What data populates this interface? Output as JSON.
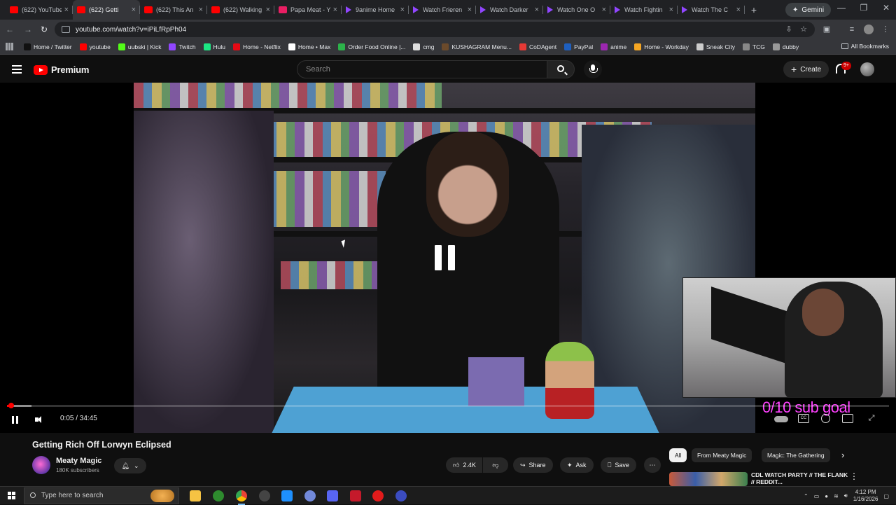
{
  "browser": {
    "tabs": [
      {
        "title": "(622) YouTube",
        "favicon": "youtube-icon",
        "active": false
      },
      {
        "title": "(622) Getti",
        "favicon": "youtube-icon",
        "active": true
      },
      {
        "title": "(622) This An",
        "favicon": "youtube-icon",
        "active": false
      },
      {
        "title": "(622) Walking",
        "favicon": "youtube-icon",
        "active": false
      },
      {
        "title": "Papa Meat - Y",
        "favicon": "papa-meat-icon",
        "active": false
      },
      {
        "title": "9anime Home",
        "favicon": "play-triangle-icon",
        "active": false
      },
      {
        "title": "Watch Frieren",
        "favicon": "play-triangle-icon",
        "active": false
      },
      {
        "title": "Watch Darker",
        "favicon": "play-triangle-icon",
        "active": false
      },
      {
        "title": "Watch One O",
        "favicon": "play-triangle-icon",
        "active": false
      },
      {
        "title": "Watch Fightin",
        "favicon": "play-triangle-icon",
        "active": false
      },
      {
        "title": "Watch The C",
        "favicon": "play-triangle-icon",
        "active": false
      }
    ],
    "gemini_label": "Gemini",
    "url": "youtube.com/watch?v=iPiLfRpPh04",
    "bookmarks": [
      {
        "label": "Home / Twitter",
        "color": "#111111"
      },
      {
        "label": "youtube",
        "color": "#ff0000"
      },
      {
        "label": "uubski | Kick",
        "color": "#53fc18"
      },
      {
        "label": "Twitch",
        "color": "#9146ff"
      },
      {
        "label": "Hulu",
        "color": "#1ce783"
      },
      {
        "label": "Home - Netflix",
        "color": "#e50914"
      },
      {
        "label": "Home • Max",
        "color": "#ffffff"
      },
      {
        "label": "Order Food Online |...",
        "color": "#2cb34a"
      },
      {
        "label": "cmg",
        "color": "#dddddd"
      },
      {
        "label": "KUSHAGRAM Menu...",
        "color": "#6b4a2b"
      },
      {
        "label": "CoDAgent",
        "color": "#e53935"
      },
      {
        "label": "PayPal",
        "color": "#1e5fbf"
      },
      {
        "label": "anime",
        "color": "#9c27b0"
      },
      {
        "label": "Home - Workday",
        "color": "#f5a623"
      },
      {
        "label": "Sneak City",
        "color": "#cccccc"
      },
      {
        "label": "TCG",
        "color": "#888888"
      },
      {
        "label": "dubby",
        "color": "#999999"
      }
    ],
    "all_bookmarks": "All Bookmarks"
  },
  "youtube": {
    "logo_text": "Premium",
    "search_placeholder": "Search",
    "create_label": "Create",
    "notification_count": "9+",
    "player": {
      "current_time": "0:05",
      "duration": "34:45",
      "time_display": "0:05 / 34:45",
      "progress_fraction": 0.0024,
      "buffer_fraction": 0.028,
      "overlay_text": "0/10 sub goal"
    },
    "video": {
      "title": "Getting Rich Off Lorwyn Eclipsed",
      "channel": "Meaty Magic",
      "subscribers": "180K subscribers",
      "likes": "2.4K",
      "share_label": "Share",
      "ask_label": "Ask",
      "save_label": "Save"
    },
    "chips": [
      "All",
      "From Meaty Magic",
      "Magic: The Gathering"
    ],
    "recommendation_title": "CDL WATCH PARTY // THE FLANK // REDDIT..."
  },
  "taskbar": {
    "search_placeholder": "Type here to search",
    "time": "4:12 PM",
    "date": "1/16/2026"
  },
  "colors": {
    "youtube_red": "#ff0000",
    "sub_goal": "#ff40ff",
    "background": "#0f0f0f"
  }
}
